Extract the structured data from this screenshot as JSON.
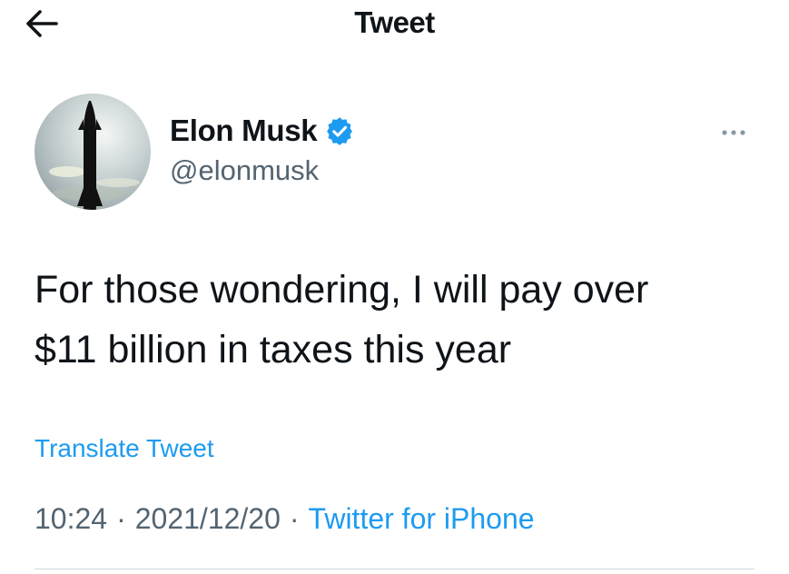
{
  "header": {
    "title": "Tweet",
    "back_icon": "arrow-left-icon"
  },
  "author": {
    "display_name": "Elon Musk",
    "handle": "@elonmusk",
    "verified_icon": "verified-badge-icon",
    "avatar": "starship-avatar"
  },
  "more_icon": "more-dots-icon",
  "tweet": {
    "text_line1": "For those wondering, I will pay over",
    "text_line2": "$11 billion in taxes this year",
    "translate_label": "Translate Tweet"
  },
  "meta": {
    "time": "10:24",
    "date": "2021/12/20",
    "separator": "·",
    "source": "Twitter for iPhone"
  },
  "colors": {
    "accent": "#1d9bf0",
    "text": "#0f1419",
    "secondary": "#536471"
  }
}
